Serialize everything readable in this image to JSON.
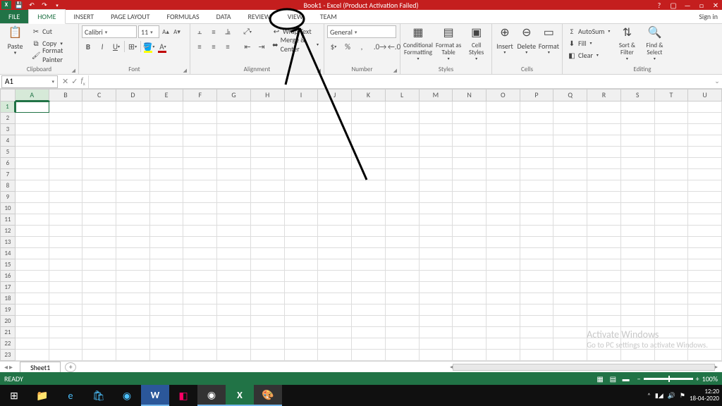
{
  "titlebar": {
    "title": "Book1 - Excel (Product Activation Failed)",
    "help": "?"
  },
  "tabs": {
    "file": "FILE",
    "items": [
      "HOME",
      "INSERT",
      "PAGE LAYOUT",
      "FORMULAS",
      "DATA",
      "REVIEW",
      "VIEW",
      "TEAM"
    ],
    "active": "HOME",
    "signin": "Sign in"
  },
  "ribbon": {
    "clipboard": {
      "label": "Clipboard",
      "paste": "Paste",
      "cut": "Cut",
      "copy": "Copy",
      "painter": "Format Painter"
    },
    "font": {
      "label": "Font",
      "name": "Calibri",
      "size": "11"
    },
    "alignment": {
      "label": "Alignment",
      "wrap": "Wrap Text",
      "merge": "Merge & Center"
    },
    "number": {
      "label": "Number",
      "format": "General"
    },
    "styles": {
      "label": "Styles",
      "cond": "Conditional Formatting",
      "table": "Format as Table",
      "cell": "Cell Styles"
    },
    "cells": {
      "label": "Cells",
      "insert": "Insert",
      "delete": "Delete",
      "format": "Format"
    },
    "editing": {
      "label": "Editing",
      "sum": "AutoSum",
      "fill": "Fill",
      "clear": "Clear",
      "sort": "Sort & Filter",
      "find": "Find & Select"
    }
  },
  "fxbar": {
    "name": "A1"
  },
  "grid": {
    "cols": [
      "A",
      "B",
      "C",
      "D",
      "E",
      "F",
      "G",
      "H",
      "I",
      "J",
      "K",
      "L",
      "M",
      "N",
      "O",
      "P",
      "Q",
      "R",
      "S",
      "T",
      "U"
    ],
    "rows": [
      1,
      2,
      3,
      4,
      5,
      6,
      7,
      8,
      9,
      10,
      11,
      12,
      13,
      14,
      15,
      16,
      17,
      18,
      19,
      20,
      21,
      22,
      23
    ],
    "selected": "A1"
  },
  "sheets": {
    "active": "Sheet1"
  },
  "status": {
    "ready": "READY",
    "zoom": "100%"
  },
  "watermark": {
    "title": "Activate Windows",
    "sub": "Go to PC settings to activate Windows."
  },
  "taskbar": {
    "time": "12:20",
    "date": "18-04-2020"
  }
}
